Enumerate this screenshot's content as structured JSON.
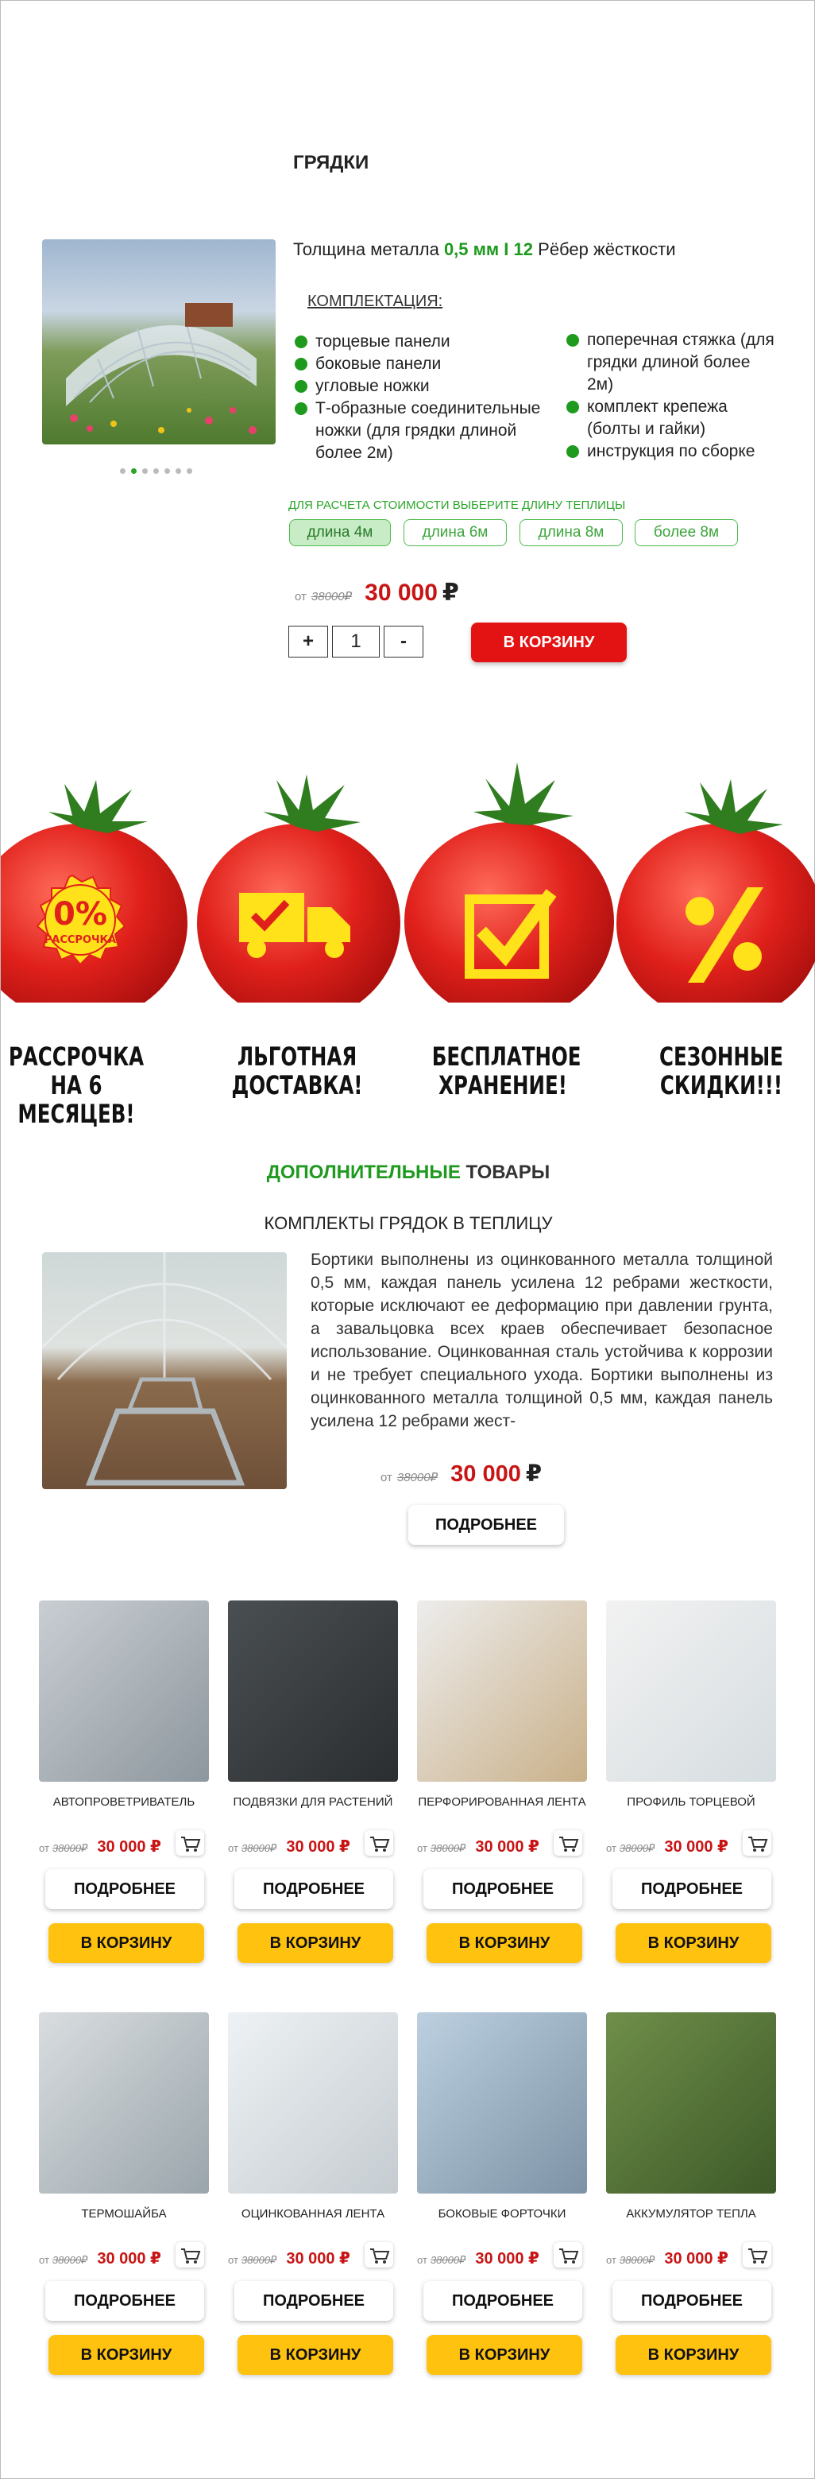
{
  "product": {
    "title": "ГРЯДКИ",
    "spec_prefix": "Толщина металла",
    "spec_thickness": "0,5 мм I",
    "spec_ribs_num": "12",
    "spec_ribs_text": "Рёбер жёсткости",
    "kit_title": "КОМПЛЕКТАЦИЯ:",
    "kit_left": [
      "торцевые панели",
      "боковые панели",
      "угловые ножки",
      "Т-образные соединительные ножки (для грядки длиной более 2м)"
    ],
    "kit_right": [
      "поперечная стяжка (для грядки длиной более 2м)",
      "комплект крепежа (болты и гайки)",
      "инструкция по сборке"
    ],
    "length_hint": "ДЛЯ РАСЧЕТА СТОИМОСТИ ВЫБЕРИТЕ ДЛИНУ ТЕПЛИЦЫ",
    "lengths": [
      "длина 4м",
      "длина 6м",
      "длина 8м",
      "более 8м"
    ],
    "price_from": "от",
    "price_old": "38000₽",
    "price": "30 000",
    "currency": "₽",
    "qty_minus": "-",
    "qty_plus": "+",
    "qty_value": "1",
    "cart_button": "В КОРЗИНУ",
    "slider_dots": 7,
    "slider_active": 1
  },
  "benefits": [
    {
      "line1": "РАССРОЧКА",
      "line2": "НА 6 МЕСЯЦЕВ!",
      "badge_pct": "0%",
      "badge_text": "РАССРОЧКА",
      "icon": "installment-badge-icon"
    },
    {
      "line1": "ЛЬГОТНАЯ",
      "line2": "ДОСТАВКА!",
      "icon": "delivery-truck-icon"
    },
    {
      "line1": "БЕСПЛАТНОЕ",
      "line2": "ХРАНЕНИЕ!",
      "icon": "checkbox-icon"
    },
    {
      "line1": "СЕЗОННЫЕ",
      "line2": "СКИДКИ!!!",
      "icon": "percent-icon"
    }
  ],
  "additional": {
    "heading_green": "ДОПОЛНИТЕЛЬНЫЕ",
    "heading_dark": "ТОВАРЫ",
    "kit_title": "КОМПЛЕКТЫ ГРЯДОК В ТЕПЛИЦУ",
    "kit_description": "Бортики выполнены из оцинкованного металла толщиной 0,5 мм, каждая панель усилена 12 ребрами жесткости, которые исключают ее деформацию при давлении грунта, а завальцовка всех краев обеспечивает безопасное использование. Оцинкованная сталь устойчива к коррозии и не требует специального ухода. Бортики выполнены из оцинкованного металла толщиной 0,5 мм, каждая панель усилена 12 ребрами жест-",
    "price_from": "от",
    "price_old": "38000₽",
    "price": "30 000",
    "currency": "₽",
    "more_button": "ПОДРОБНЕЕ"
  },
  "products": [
    {
      "name": "АВТОПРОВЕТРИВАТЕЛЬ",
      "from": "от",
      "old": "38000₽",
      "price": "30 000 ₽",
      "more": "ПОДРОБНЕЕ",
      "cart": "В КОРЗИНУ"
    },
    {
      "name": "ПОДВЯЗКИ ДЛЯ РАСТЕНИЙ",
      "from": "от",
      "old": "38000₽",
      "price": "30 000 ₽",
      "more": "ПОДРОБНЕЕ",
      "cart": "В КОРЗИНУ"
    },
    {
      "name": "ПЕРФОРИРОВАННАЯ ЛЕНТА",
      "from": "от",
      "old": "38000₽",
      "price": "30 000 ₽",
      "more": "ПОДРОБНЕЕ",
      "cart": "В КОРЗИНУ"
    },
    {
      "name": "ПРОФИЛЬ ТОРЦЕВОЙ",
      "from": "от",
      "old": "38000₽",
      "price": "30 000 ₽",
      "more": "ПОДРОБНЕЕ",
      "cart": "В КОРЗИНУ"
    },
    {
      "name": "ТЕРМОШАЙБА",
      "from": "от",
      "old": "38000₽",
      "price": "30 000 ₽",
      "more": "ПОДРОБНЕЕ",
      "cart": "В КОРЗИНУ"
    },
    {
      "name": "ОЦИНКОВАННАЯ ЛЕНТА",
      "from": "от",
      "old": "38000₽",
      "price": "30 000 ₽",
      "more": "ПОДРОБНЕЕ",
      "cart": "В КОРЗИНУ"
    },
    {
      "name": "БОКОВЫЕ ФОРТОЧКИ",
      "from": "от",
      "old": "38000₽",
      "price": "30 000 ₽",
      "more": "ПОДРОБНЕЕ",
      "cart": "В КОРЗИНУ"
    },
    {
      "name": "АККУМУЛЯТОР ТЕПЛА",
      "from": "от",
      "old": "38000₽",
      "price": "30 000 ₽",
      "more": "ПОДРОБНЕЕ",
      "cart": "В КОРЗИНУ"
    }
  ],
  "colors": {
    "accent_green": "#1e9a1e",
    "price_red": "#c81414",
    "cart_red": "#e31313",
    "button_yellow": "#ffc20e",
    "tomato": "#e0201b"
  }
}
